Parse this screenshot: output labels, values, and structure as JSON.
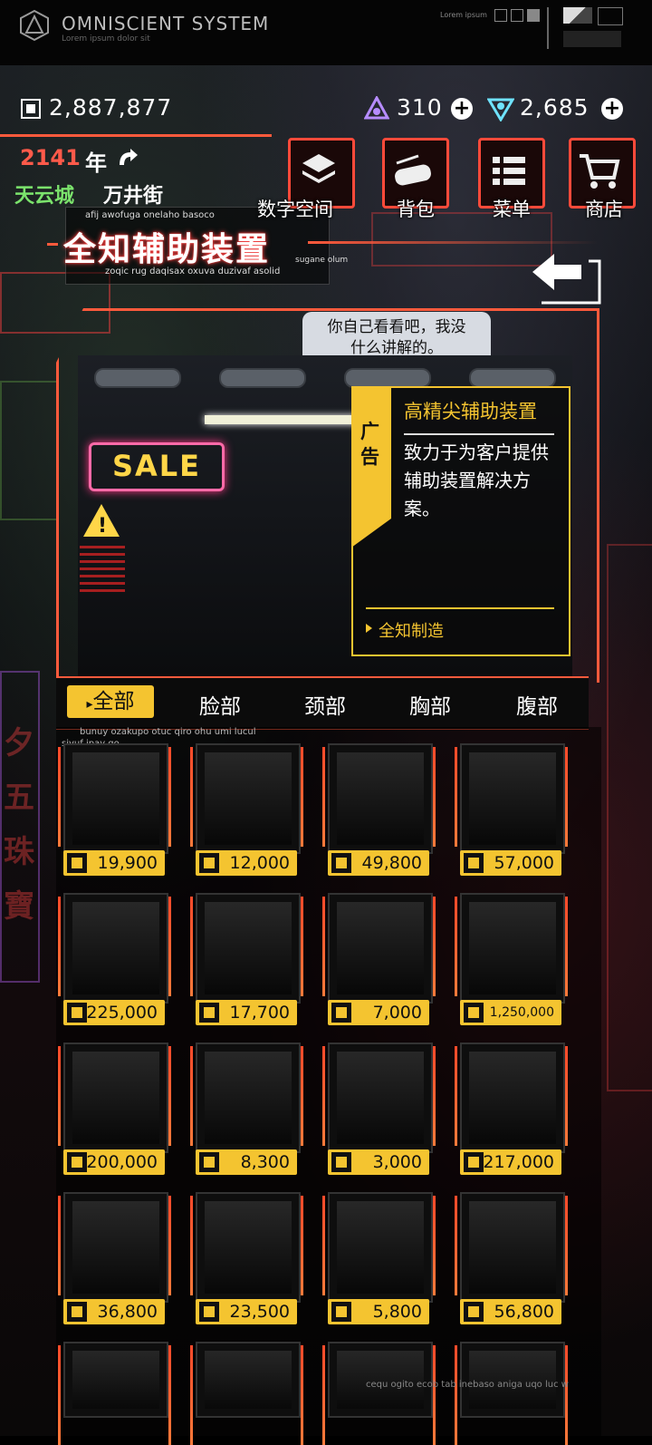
{
  "system_bar": {
    "title": "OMNISCIENT SYSTEM",
    "subtitle": "Lorem ipsum dolor sit",
    "mini_label": "Lorem ipsum"
  },
  "currency": {
    "chips": "2,887,877",
    "purple_gems": "310",
    "blue_gems": "2,685"
  },
  "header": {
    "year": "2141",
    "year_suffix": "年",
    "city": "天云城",
    "street": "万井街",
    "title_sub_top": "afij awofuga onelaho basoco",
    "title": "全知辅助装置",
    "title_tag": "sugane olum",
    "title_sub_bottom": "zoqic rug daqisax oxuva duzivaf asolid"
  },
  "toolbar": {
    "digital_space": "数字空间",
    "backpack": "背包",
    "menu": "菜单",
    "shop": "商店"
  },
  "bubble": {
    "line1": "你自己看看吧，我没",
    "line2": "什么讲解的。"
  },
  "kiosk": {
    "sale_sign": "SALE"
  },
  "ad": {
    "tab": "广告",
    "title": "高精尖辅助装置",
    "body": "致力于为客户提供辅助装置解决方案。",
    "maker": "全知制造"
  },
  "tabs": {
    "items": [
      "全部",
      "脸部",
      "颈部",
      "胸部",
      "腹部"
    ],
    "sub1": "bunuy ozakupo otuc qiro ohu umi lucul",
    "sub2": "sivuf ipay qo"
  },
  "items": [
    {
      "price": "19,900"
    },
    {
      "price": "12,000"
    },
    {
      "price": "49,800"
    },
    {
      "price": "57,000"
    },
    {
      "price": "225,000"
    },
    {
      "price": "17,700"
    },
    {
      "price": "7,000"
    },
    {
      "price": "1,250,000"
    },
    {
      "price": "200,000"
    },
    {
      "price": "8,300"
    },
    {
      "price": "3,000"
    },
    {
      "price": "217,000"
    },
    {
      "price": "36,800"
    },
    {
      "price": "23,500"
    },
    {
      "price": "5,800"
    },
    {
      "price": "56,800"
    }
  ],
  "footer_text": "cequ ogito ecob tab inebaso aniga uqo luc w",
  "colors": {
    "accent_yellow": "#f4c430",
    "neon_red": "#ff5a3c",
    "location_green": "#7be36c"
  }
}
